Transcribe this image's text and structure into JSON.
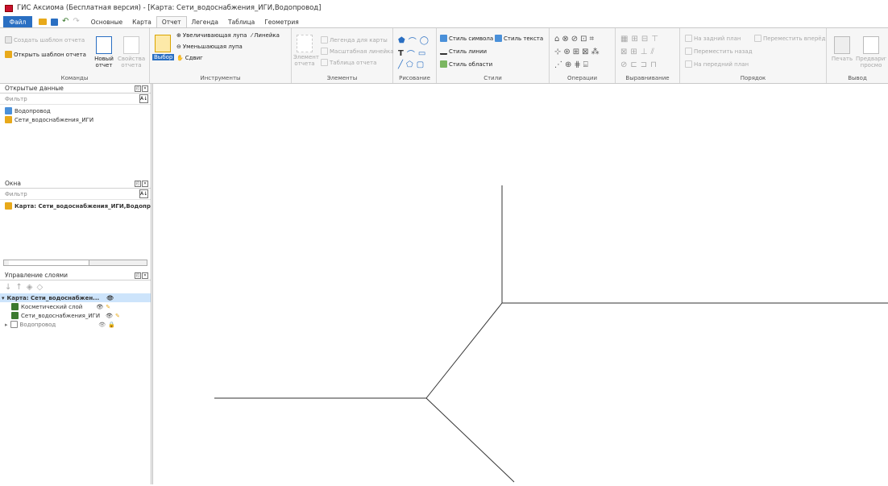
{
  "app": {
    "title": "ГИС Аксиома (Бесплатная версия) - [Карта: Сети_водоснабжения_ИГИ,Водопровод]",
    "icon": "app-icon"
  },
  "menu": {
    "file": "Файл",
    "tabs": [
      "Основные",
      "Карта",
      "Отчет",
      "Легенда",
      "Таблица",
      "Геометрия"
    ],
    "active": "Отчет"
  },
  "ribbon": {
    "commands": {
      "create": "Создать шаблон отчета",
      "open": "Открыть шаблон отчета",
      "new_line1": "Новый",
      "new_line2": "отчет",
      "props_line1": "Свойства",
      "props_line2": "отчета",
      "label": "Команды"
    },
    "tools": {
      "select": "Выбор",
      "zoom_in": "Увеличивающая лупа",
      "ruler": "Линейка",
      "zoom_out": "Уменьшающая лупа",
      "pan": "Сдвиг",
      "label": "Инструменты"
    },
    "elements": {
      "legend": "Легенда для карты",
      "scale": "Масштабная линейка",
      "table": "Таблица отчета",
      "elem_line1": "Элемент",
      "elem_line2": "отчета",
      "label": "Элементы"
    },
    "drawing": {
      "label": "Рисование"
    },
    "styles": {
      "symbol": "Стиль символа",
      "text": "Стиль текста",
      "line": "Стиль линии",
      "area": "Стиль области",
      "label": "Стили"
    },
    "operations": {
      "label": "Операции"
    },
    "align": {
      "label": "Выравнивание"
    },
    "order": {
      "back": "На задний план",
      "forward": "Переместить вперёд",
      "move_back": "Переместить назад",
      "front": "На передний план",
      "label": "Порядок"
    },
    "output": {
      "print": "Печать",
      "preview_line1": "Предварите",
      "preview_line2": "просмо",
      "label": "Вывод"
    }
  },
  "open_data": {
    "title": "Открытые данные",
    "filter": "Фильтр",
    "items": [
      "Водопровод",
      "Сети_водоснабжения_ИГИ"
    ]
  },
  "windows": {
    "title": "Окна",
    "filter": "Фильтр",
    "items": [
      "Карта: Сети_водоснабжения_ИГИ,Водопр"
    ]
  },
  "layers": {
    "title": "Управление слоями",
    "map": "Карта: Сети_водоснабжен...",
    "items": [
      "Косметический слой",
      "Сети_водоснабжения_ИГИ",
      "Водопровод"
    ]
  },
  "colors": {
    "accent": "#2a6fc2",
    "selection": "#cde4fb"
  }
}
